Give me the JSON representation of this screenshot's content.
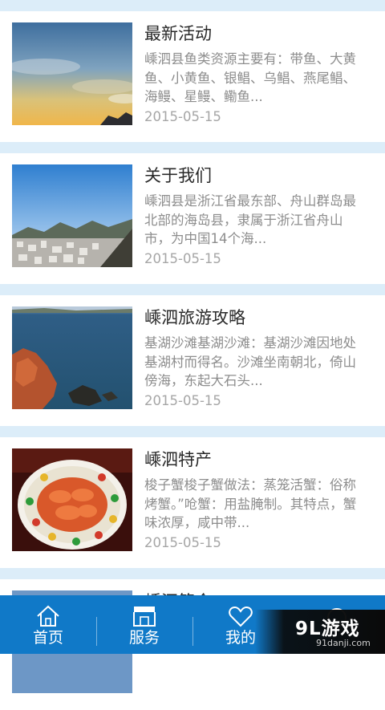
{
  "articles": [
    {
      "title": "最新活动",
      "summary": "嵊泗县鱼类资源主要有：带鱼、大黄鱼、小黄鱼、银鲳、乌鲳、燕尾鲳、海鳗、星鳗、鳓鱼...",
      "date": "2015-05-15",
      "image": "sunset-sky-photo"
    },
    {
      "title": "关于我们",
      "summary": "嵊泗县是浙江省最东部、舟山群岛最北部的海岛县，隶属于浙江省舟山市，为中国14个海...",
      "date": "2015-05-15",
      "image": "coastal-town-photo"
    },
    {
      "title": "嵊泗旅游攻略",
      "summary": "基湖沙滩基湖沙滩：基湖沙滩因地处基湖村而得名。沙滩坐南朝北，倚山傍海，东起大石头...",
      "date": "2015-05-15",
      "image": "sea-rocks-photo"
    },
    {
      "title": "嵊泗特产",
      "summary": "梭子蟹梭子蟹做法：蒸笼活蟹：俗称烤蟹。”呛蟹：用盐腌制。其特点，蟹味浓厚，咸中带...",
      "date": "2015-05-15",
      "image": "shrimp-dish-photo"
    },
    {
      "title": "嵊泗简介",
      "summary": "",
      "date": "",
      "image": "sky-photo"
    }
  ],
  "tabbar": {
    "tabs": [
      {
        "label": "首页",
        "icon": "home-icon"
      },
      {
        "label": "服务",
        "icon": "shop-icon"
      },
      {
        "label": "我的",
        "icon": "heart-icon"
      },
      {
        "label": "",
        "icon": "circle-icon"
      }
    ]
  },
  "watermark": {
    "logo": "9L游戏",
    "url": "91danji.com"
  },
  "colors": {
    "background": "#dcedf9",
    "tabbar": "#1079c8",
    "title": "#2a2a2a",
    "summary": "#8d8d8d",
    "date": "#a6a6a6"
  }
}
